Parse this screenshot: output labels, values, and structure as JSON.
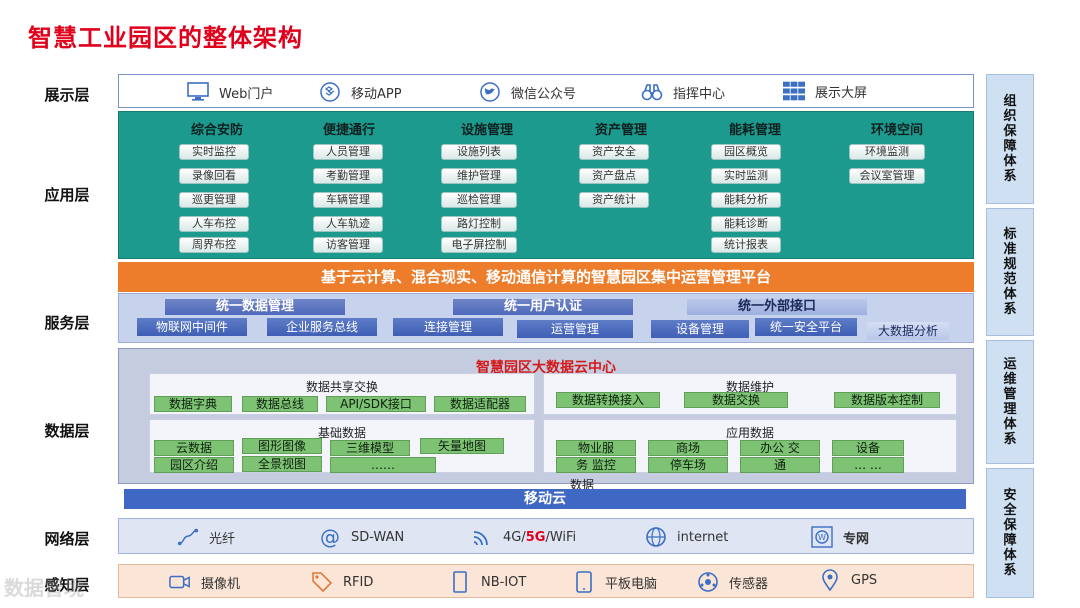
{
  "title": "智慧工业园区的整体架构",
  "layers": {
    "display": "展示层",
    "application": "应用层",
    "service": "服务层",
    "data": "数据层",
    "network": "网络层",
    "perception": "感知层"
  },
  "display_items": [
    {
      "label": "Web门户",
      "icon": "monitor-icon"
    },
    {
      "label": "移动APP",
      "icon": "dropbox-icon"
    },
    {
      "label": "微信公众号",
      "icon": "bird-icon"
    },
    {
      "label": "指挥中心",
      "icon": "binoculars-icon"
    },
    {
      "label": "展示大屏",
      "icon": "grid-icon"
    }
  ],
  "app_columns": [
    {
      "head": "综合安防",
      "items": [
        "实时监控",
        "录像回看",
        "巡更管理",
        "人车布控",
        "周界布控"
      ]
    },
    {
      "head": "便捷通行",
      "items": [
        "人员管理",
        "考勤管理",
        "车辆管理",
        "人车轨迹",
        "访客管理"
      ]
    },
    {
      "head": "设施管理",
      "items": [
        "设施列表",
        "维护管理",
        "巡检管理",
        "路灯控制",
        "电子屏控制"
      ]
    },
    {
      "head": "资产管理",
      "items": [
        "资产安全",
        "资产盘点",
        "资产统计"
      ]
    },
    {
      "head": "能耗管理",
      "items": [
        "园区概览",
        "实时监测",
        "能耗分析",
        "能耗诊断",
        "统计报表"
      ]
    },
    {
      "head": "环境空间",
      "items": [
        "环境监测",
        "会议室管理"
      ]
    }
  ],
  "platform": "基于云计算、混合现实、移动通信计算的智慧园区集中运营管理平台",
  "service": {
    "top": [
      "统一数据管理",
      "统一用户认证",
      "统一外部接口"
    ],
    "bottom": [
      "物联网中间件",
      "企业服务总线",
      "连接管理",
      "运营管理",
      "设备管理",
      "统一安全平台",
      "大数据分析"
    ]
  },
  "data_center": {
    "title": "智慧园区大数据云中心",
    "share": {
      "head": "数据共享交换",
      "items": [
        "数据字典",
        "数据总线",
        "API/SDK接口",
        "数据适配器"
      ]
    },
    "maint": {
      "head": "数据维护",
      "items": [
        "数据转换接入",
        "数据交换",
        "数据版本控制"
      ]
    },
    "basic": {
      "head": "基础数据",
      "items": [
        "云数据",
        "图形图像",
        "三维模型",
        "矢量地图",
        "园区介绍",
        "全景视图",
        "……"
      ]
    },
    "appdata": {
      "head": "应用数据",
      "items": [
        "物业服",
        "务 监控",
        "数据",
        "商场",
        "停车场",
        "办公 交",
        "通",
        "设备",
        "… …"
      ]
    }
  },
  "mobile_cloud": "移动云",
  "network_items": [
    {
      "label": "光纤",
      "icon": "fiber-icon"
    },
    {
      "label": "SD-WAN",
      "icon": "at-icon"
    },
    {
      "label_a": "4G/",
      "label_b": "5G",
      "label_c": "/WiFi",
      "icon": "wifi-icon"
    },
    {
      "label": "internet",
      "icon": "globe-icon"
    },
    {
      "label": "专网",
      "icon": "wordpress-icon"
    }
  ],
  "perception_items": [
    {
      "label": "摄像机",
      "icon": "camera-icon"
    },
    {
      "label": "RFID",
      "icon": "tag-icon"
    },
    {
      "label": "NB-IOT",
      "icon": "chip-icon"
    },
    {
      "label": "平板电脑",
      "icon": "tablet-icon"
    },
    {
      "label": "传感器",
      "icon": "sensor-icon"
    },
    {
      "label": "GPS",
      "icon": "pin-icon"
    }
  ],
  "side_boxes": [
    "组织保障体系",
    "标准规范体系",
    "运维管理体系",
    "安全保障体系"
  ],
  "watermark": "数据智境",
  "colors": {
    "title": "#e0001b",
    "app": "#1d9a8e",
    "platform": "#ee7d2b",
    "mobile": "#3f67c4",
    "green": "#7dc373"
  }
}
